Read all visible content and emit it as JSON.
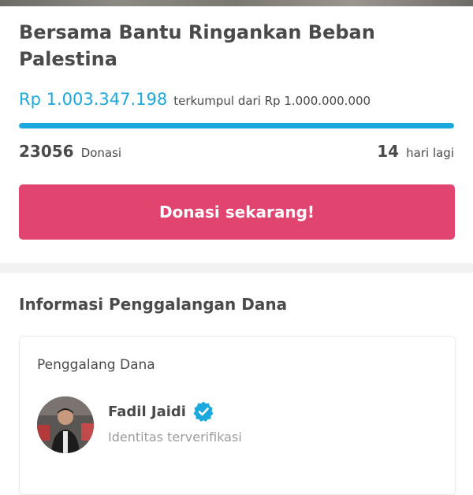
{
  "campaign": {
    "title": "Bersama Bantu Ringankan Beban Palestina",
    "amount_collected": "Rp 1.003.347.198",
    "target_text": "terkumpul dari Rp 1.000.000.000",
    "progress": 1.0,
    "donations_count": "23056",
    "donations_label": "Donasi",
    "days_left": "14",
    "days_left_label": "hari lagi"
  },
  "donate_button": {
    "label": "Donasi sekarang!"
  },
  "fundraising_info": {
    "section_title": "Informasi Penggalangan Dana",
    "card_title": "Penggalang Dana",
    "fundraiser_name": "Fadil Jaidi",
    "verified_text": "Identitas terverifikasi"
  },
  "colors": {
    "accent_blue": "#1aa8de",
    "button_pink": "#e1456f",
    "text_dark": "#4a4a4a",
    "text_muted": "#9b9b9b"
  },
  "icons": {
    "verified": "verified-badge-icon",
    "avatar": "user-avatar"
  }
}
